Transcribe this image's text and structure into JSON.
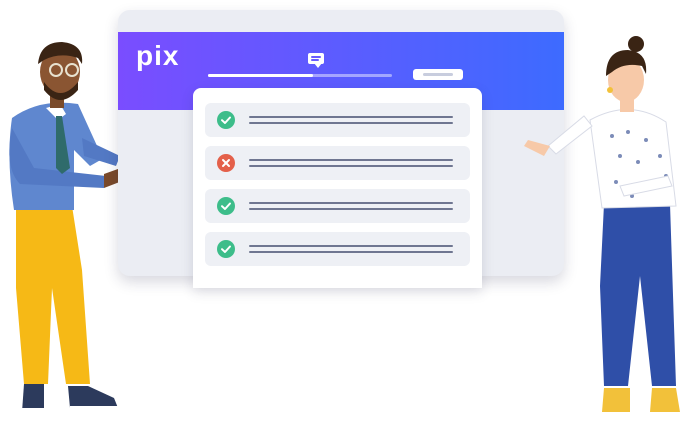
{
  "brand": {
    "logo_text": "pix",
    "header_colors": [
      "#7a4dff",
      "#3d6bff"
    ]
  },
  "progress": {
    "fraction": 0.57
  },
  "results": [
    {
      "status": "correct",
      "icon": "check-icon",
      "color": "#3dbd8a"
    },
    {
      "status": "incorrect",
      "icon": "cross-icon",
      "color": "#e4604a"
    },
    {
      "status": "correct",
      "icon": "check-icon",
      "color": "#3dbd8a"
    },
    {
      "status": "correct",
      "icon": "check-icon",
      "color": "#3dbd8a"
    }
  ]
}
